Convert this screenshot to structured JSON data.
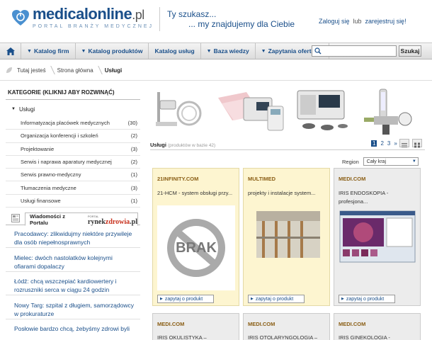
{
  "header": {
    "logo_main": "medicalonline",
    "logo_suffix": ".pl",
    "logo_sub": "PORTAL BRANŻY MEDYCZNEJ",
    "slogan_line1": "Ty szukasz...",
    "slogan_line2": "... my znajdujemy dla Ciebie",
    "login": "Zaloguj się",
    "or": "lub",
    "register": "zarejestruj się!"
  },
  "nav": {
    "items": [
      "Katalog firm",
      "Katalog produktów",
      "Katalog usług",
      "Baza wiedzy",
      "Zapytania ofertowe"
    ],
    "search_placeholder": "",
    "search_button": "Szukaj"
  },
  "breadcrumb": [
    "Tutaj jesteś",
    "Strona główna",
    "Usługi"
  ],
  "sidebar": {
    "title": "KATEGORIE (KLIKNIJ ABY ROZWINĄĆ)",
    "root": "Usługi",
    "items": [
      {
        "label": "Informatyzacja placówek medycznych",
        "count": "(30)"
      },
      {
        "label": "Organizacja konferencji i szkoleń",
        "count": "(2)"
      },
      {
        "label": "Projektowanie",
        "count": "(3)"
      },
      {
        "label": "Serwis i naprawa aparatury medycznej",
        "count": "(2)"
      },
      {
        "label": "Serwis prawno-medyczny",
        "count": "(1)"
      },
      {
        "label": "Tłumaczenia medyczne",
        "count": "(3)"
      },
      {
        "label": "Usługi finansowe",
        "count": "(1)"
      }
    ]
  },
  "news": {
    "tab_label": "Wiadomości z Portalu",
    "portal_tiny": "PORTAL",
    "portal_name_1": "rynek",
    "portal_name_2": "zdrowia",
    "portal_name_3": ".pl",
    "items": [
      "Pracodawcy: zlikwidujmy niektóre przywileje dla osób niepełnosprawnych",
      "Mielec: dwóch nastolatków kolejnymi ofiarami dopalaczy",
      "Łódź: chcą wszczepiać kardiowertery i rozruszniki serca w ciągu 24 godzin",
      "Nowy Targ: szpital z długiem, samorządowcy w prokuraturze",
      "Posłowie bardzo chcą, żebyśmy zdrowi byli"
    ]
  },
  "section": {
    "title": "Usługi",
    "count_text": "(produktów w bazie 42)",
    "pages": [
      "1",
      "2",
      "3"
    ],
    "next": "»",
    "region_label": "Region",
    "region_value": "Cały kraj"
  },
  "cards": [
    {
      "company": "21INFINITY.COM",
      "product": "21-HCM - system obsługi przy...",
      "thumb_text": "BRAK",
      "ask": "zapytaj o produkt"
    },
    {
      "company": "MULTIMED",
      "product": "projekty i instalacje system...",
      "ask": "zapytaj o produkt"
    },
    {
      "company": "MEDI.COM",
      "product": "IRIS ENDOSKOPIA - profesjona...",
      "ask": "zapytaj o produkt"
    }
  ],
  "cards_row2": [
    {
      "company": "MEDI.COM",
      "product": "IRIS OKULISTYKA –"
    },
    {
      "company": "MEDI.COM",
      "product": "IRIS OTOLARYNGOLOGIA –"
    },
    {
      "company": "MEDI.COM",
      "product": "IRIS GINEKOLOGIA -"
    }
  ],
  "colors": {
    "brand": "#1a4f8a",
    "card_highlight": "#fdf5d0",
    "card_gray": "#ececec"
  }
}
